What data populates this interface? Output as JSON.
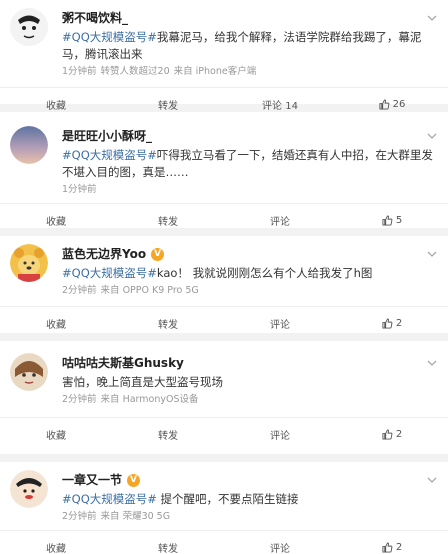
{
  "posts": [
    {
      "name": "粥不喝饮料_",
      "verified": false,
      "tag": "#QQ大规模盗号#",
      "text": "我幕泥马，给我个解释，法语学院群给我踢了，幕泥马，腾讯滚出来",
      "time": "1分钟前",
      "repost_source": "转赞人数超过20",
      "device": "来自 iPhone客户端",
      "actions": {
        "forward": "收藏",
        "repost": "转发",
        "comment": "评论 14",
        "like": "26"
      },
      "avatar_color": "#e9e9e9"
    },
    {
      "name": "是旺旺小小酥呀_",
      "verified": false,
      "tag": "#QQ大规模盗号#",
      "text": "吓得我立马看了一下，结婚还真有人中招，在大群里发不堪入目的图，真是……",
      "time": "1分钟前",
      "repost_source": "",
      "device": "",
      "actions": {
        "forward": "收藏",
        "repost": "转发",
        "comment": "评论",
        "like": "5"
      },
      "avatar_color": "#7d8fb0"
    },
    {
      "name": "蓝色无边界Yoo",
      "verified": true,
      "tag": "#QQ大规模盗号#",
      "text": "kao！ 我就说刚刚怎么有个人给我发了h图",
      "time": "2分钟前",
      "repost_source": "",
      "device": "来自 OPPO K9 Pro 5G",
      "actions": {
        "forward": "收藏",
        "repost": "转发",
        "comment": "评论",
        "like": "2"
      },
      "avatar_color": "#e8a63a"
    },
    {
      "name": "咕咕咕夫斯基Ghusky",
      "verified": false,
      "tag": "",
      "text": "害怕，晚上简直是大型盗号现场",
      "time": "2分钟前",
      "repost_source": "",
      "device": "来自 HarmonyOS设备",
      "actions": {
        "forward": "收藏",
        "repost": "转发",
        "comment": "评论",
        "like": "2"
      },
      "avatar_color": "#c9a27a"
    },
    {
      "name": "一章又一节",
      "verified": true,
      "tag": "#QQ大规模盗号#",
      "text": " 提个醒吧，不要点陌生链接",
      "time": "2分钟前",
      "repost_source": "",
      "device": "来自 荣耀30 5G",
      "actions": {
        "forward": "收藏",
        "repost": "转发",
        "comment": "评论",
        "like": "2"
      },
      "avatar_color": "#d63b3b"
    }
  ],
  "colors": {
    "tag": "#3b6ea5",
    "badge": "#f5a623",
    "meta": "#999999"
  }
}
